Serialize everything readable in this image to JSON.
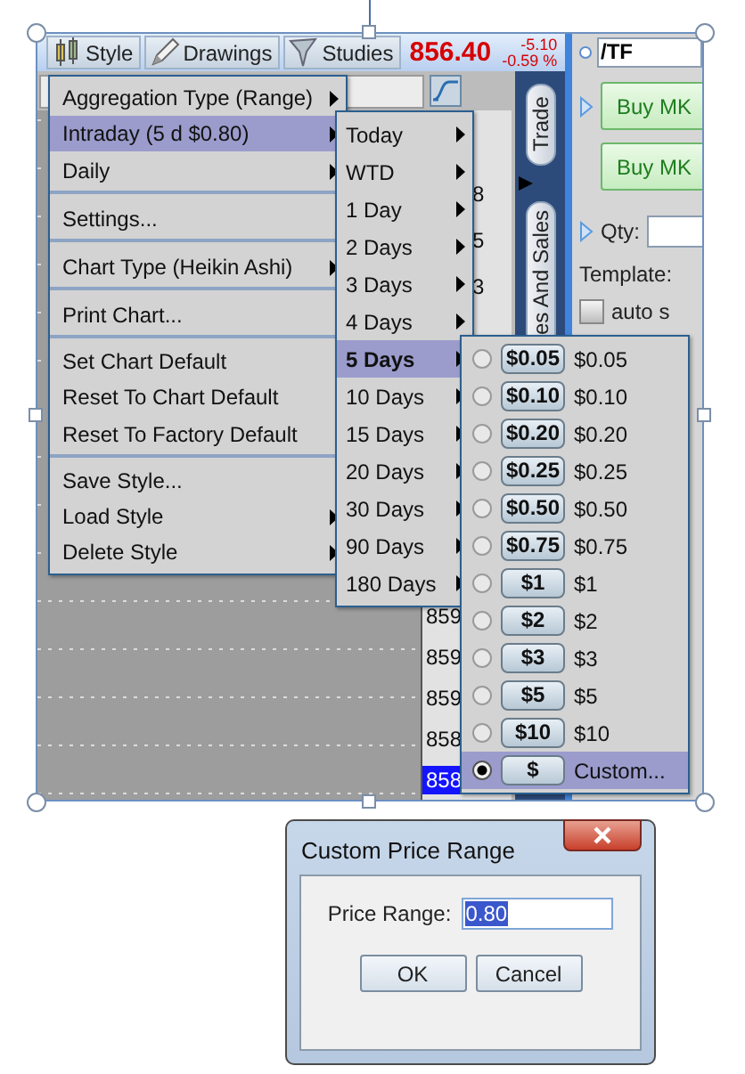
{
  "toolbar": {
    "buttons": [
      {
        "label": "Style",
        "kind": "style"
      },
      {
        "label": "Drawings",
        "kind": "drawings"
      },
      {
        "label": "Studies",
        "kind": "studies"
      }
    ],
    "price": "856.40",
    "change": "-5.10",
    "change_percent": "-0.59 %"
  },
  "side_tabs": [
    {
      "label": "Trade"
    },
    {
      "label": "es And Sales"
    }
  ],
  "price_axis": {
    "upper_labels": [
      "8",
      "5",
      "3"
    ],
    "lower_labels": [
      {
        "text": "859",
        "current": false
      },
      {
        "text": "859",
        "current": false
      },
      {
        "text": "859",
        "current": false
      },
      {
        "text": "858",
        "current": false
      },
      {
        "text": "858",
        "current": true
      }
    ]
  },
  "order_panel": {
    "symbol": "/TF",
    "buy_buttons": [
      "Buy MK",
      "Buy MK"
    ],
    "qty_label": "Qty:",
    "template_label": "Template:",
    "auto_checkbox": {
      "label": "auto s",
      "checked": false
    }
  },
  "context_menu": [
    {
      "label": "Aggregation Type (Range)",
      "submenu": true,
      "selected": false,
      "divider_after": false
    },
    {
      "label": "Intraday (5 d $0.80)",
      "submenu": true,
      "selected": true,
      "divider_after": false
    },
    {
      "label": "Daily",
      "submenu": true,
      "selected": false,
      "divider_after": true
    },
    {
      "label": "Settings...",
      "submenu": false,
      "selected": false,
      "divider_after": true
    },
    {
      "label": "Chart Type (Heikin Ashi)",
      "submenu": true,
      "selected": false,
      "divider_after": true
    },
    {
      "label": "Print Chart...",
      "submenu": false,
      "selected": false,
      "divider_after": true
    },
    {
      "label": "Set Chart Default",
      "submenu": false,
      "selected": false,
      "divider_after": false
    },
    {
      "label": "Reset To Chart Default",
      "submenu": false,
      "selected": false,
      "divider_after": false
    },
    {
      "label": "Reset To Factory Default",
      "submenu": false,
      "selected": false,
      "divider_after": true
    },
    {
      "label": "Save Style...",
      "submenu": false,
      "selected": false,
      "divider_after": false
    },
    {
      "label": "Load Style",
      "submenu": true,
      "selected": false,
      "divider_after": false
    },
    {
      "label": "Delete Style",
      "submenu": true,
      "selected": false,
      "divider_after": false
    }
  ],
  "intraday_menu": [
    {
      "label": "Today",
      "selected": false
    },
    {
      "label": "WTD",
      "selected": false
    },
    {
      "label": "1 Day",
      "selected": false
    },
    {
      "label": "2 Days",
      "selected": false
    },
    {
      "label": "3 Days",
      "selected": false
    },
    {
      "label": "4 Days",
      "selected": false
    },
    {
      "label": "5 Days",
      "selected": true
    },
    {
      "label": "10 Days",
      "selected": false
    },
    {
      "label": "15 Days",
      "selected": false
    },
    {
      "label": "20 Days",
      "selected": false
    },
    {
      "label": "30 Days",
      "selected": false
    },
    {
      "label": "90 Days",
      "selected": false
    },
    {
      "label": "180 Days",
      "selected": false
    }
  ],
  "range_menu": [
    {
      "chip": "$0.05",
      "label": "$0.05",
      "selected": false
    },
    {
      "chip": "$0.10",
      "label": "$0.10",
      "selected": false
    },
    {
      "chip": "$0.20",
      "label": "$0.20",
      "selected": false
    },
    {
      "chip": "$0.25",
      "label": "$0.25",
      "selected": false
    },
    {
      "chip": "$0.50",
      "label": "$0.50",
      "selected": false
    },
    {
      "chip": "$0.75",
      "label": "$0.75",
      "selected": false
    },
    {
      "chip": "$1",
      "label": "$1",
      "selected": false
    },
    {
      "chip": "$2",
      "label": "$2",
      "selected": false
    },
    {
      "chip": "$3",
      "label": "$3",
      "selected": false
    },
    {
      "chip": "$5",
      "label": "$5",
      "selected": false
    },
    {
      "chip": "$10",
      "label": "$10",
      "selected": false
    },
    {
      "chip": "$",
      "label": "Custom...",
      "selected": true
    }
  ],
  "dialog": {
    "title": "Custom Price Range",
    "field_label": "Price Range:",
    "value": "0.80",
    "buttons": [
      "OK",
      "Cancel"
    ]
  }
}
